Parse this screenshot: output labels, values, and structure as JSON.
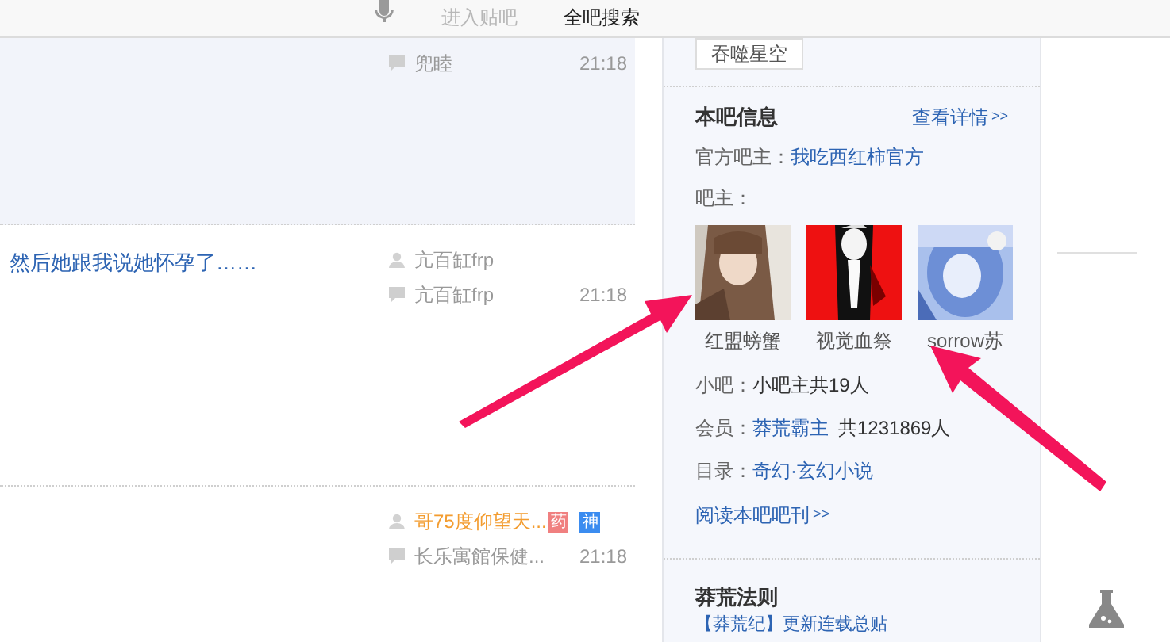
{
  "top_bar": {
    "buttons": [
      {
        "label": "进入贴吧",
        "kind": "faded"
      },
      {
        "label": "全吧搜索",
        "kind": "plain"
      }
    ]
  },
  "threads": [
    {
      "reply_author": "兜睦",
      "time": "21:18",
      "highlighted": true
    },
    {
      "title": "然后她跟我说她怀孕了……",
      "author": "亢百缸frp",
      "reply_author": "亢百缸frp",
      "time": "21:18",
      "highlighted": false
    },
    {
      "author": "哥75度仰望天...",
      "author_vip": true,
      "badges": [
        {
          "label": "药",
          "color": "#f08080"
        },
        {
          "label": "神",
          "color": "#3b8cf0"
        }
      ],
      "reply_author": "长乐寓館保健...",
      "time": "21:18",
      "highlighted": false
    }
  ],
  "sidebar": {
    "tag": "吞噬星空",
    "info_title": "本吧信息",
    "details_link": "查看详情",
    "details_arrows": ">>",
    "official_label": "官方吧主：",
    "official_name": "我吃西红柿官方",
    "owners_label": "吧主：",
    "owners": [
      {
        "name": "红盟螃蟹",
        "kind": "picture"
      },
      {
        "name": "视觉血祭",
        "kind": "picture"
      },
      {
        "name": "sorrow苏",
        "kind": "picture"
      }
    ],
    "assistants_label": "小吧：",
    "assistants_value": "小吧主共19人",
    "members_label": "会员：",
    "members_name": "莽荒霸主",
    "members_count": "共1231869人",
    "catalog_label": "目录：",
    "catalog_value": "奇幻·玄幻小说",
    "journal_link": "阅读本吧吧刊",
    "journal_arrows": ">>",
    "rules_title": "莽荒法则",
    "rules_item": "【莽荒纪】更新连载总贴"
  }
}
